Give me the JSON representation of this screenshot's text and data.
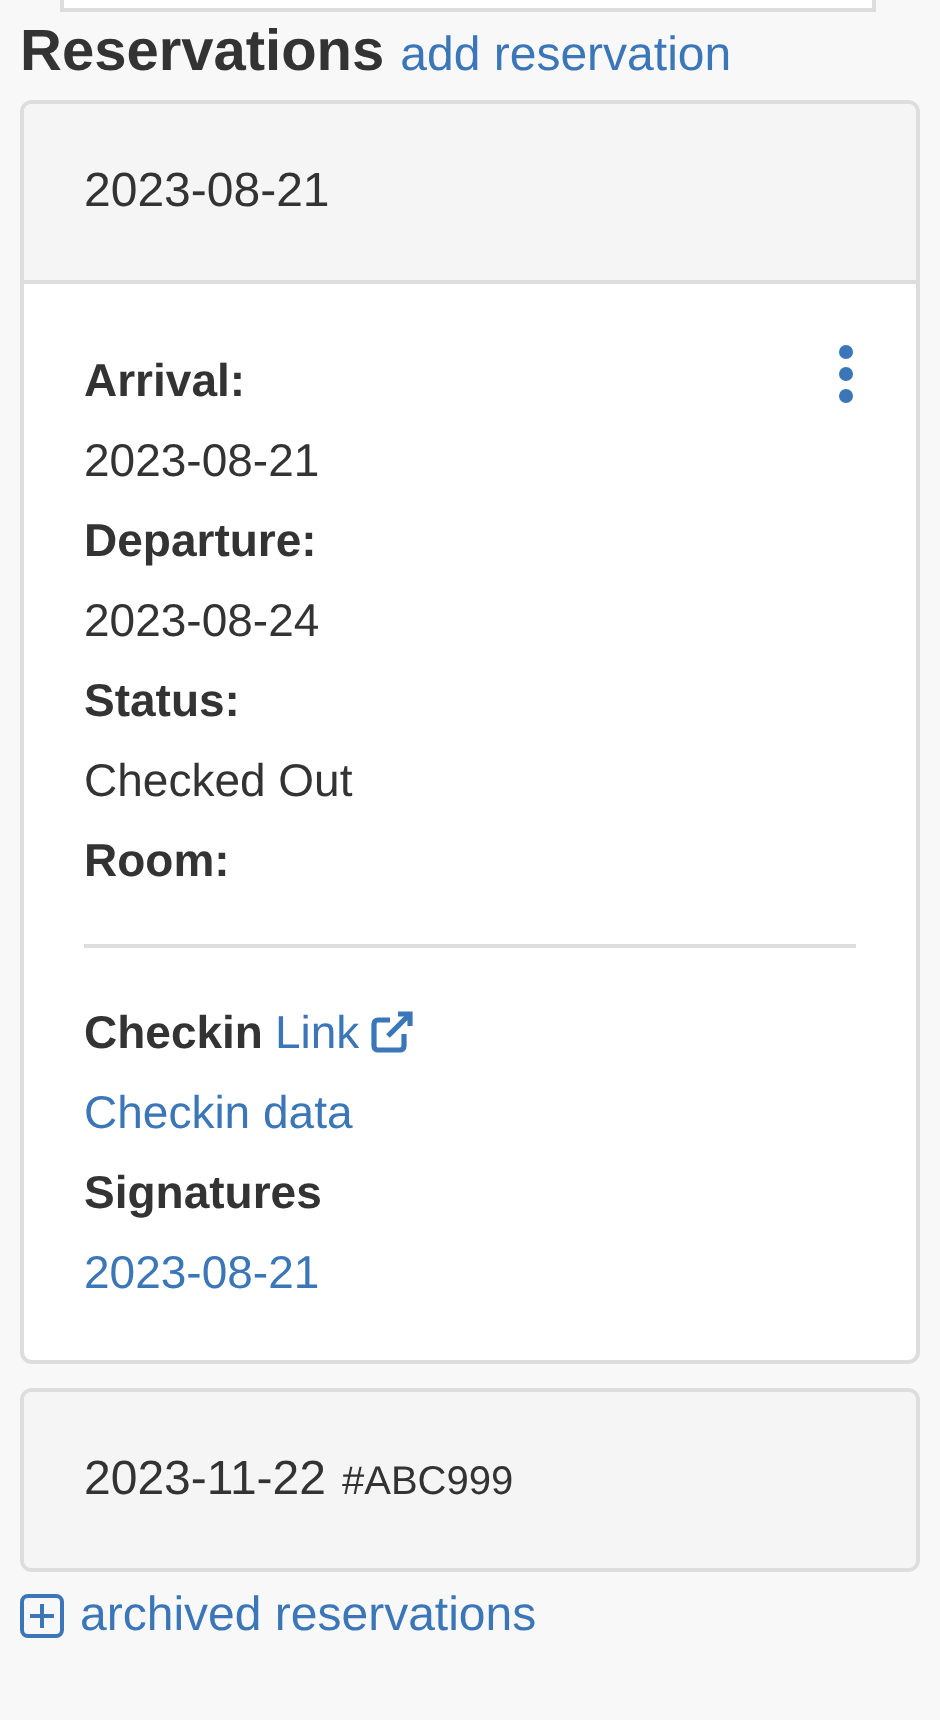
{
  "heading": "Reservations",
  "add_link": "add reservation",
  "reservations": [
    {
      "date": "2023-08-21",
      "expanded": true,
      "fields": [
        {
          "label": "Arrival:",
          "value": "2023-08-21"
        },
        {
          "label": "Departure:",
          "value": "2023-08-24"
        },
        {
          "label": "Status:",
          "value": "Checked Out"
        },
        {
          "label": "Room:"
        }
      ],
      "checkin_label": "Checkin",
      "checkin_link": "Link",
      "checkin_data": "Checkin data",
      "signatures_label": "Signatures",
      "signatures": [
        "2023-08-21"
      ]
    },
    {
      "date": "2023-11-22",
      "code": "#ABC999",
      "expanded": false
    }
  ],
  "archived_link": "archived reservations"
}
